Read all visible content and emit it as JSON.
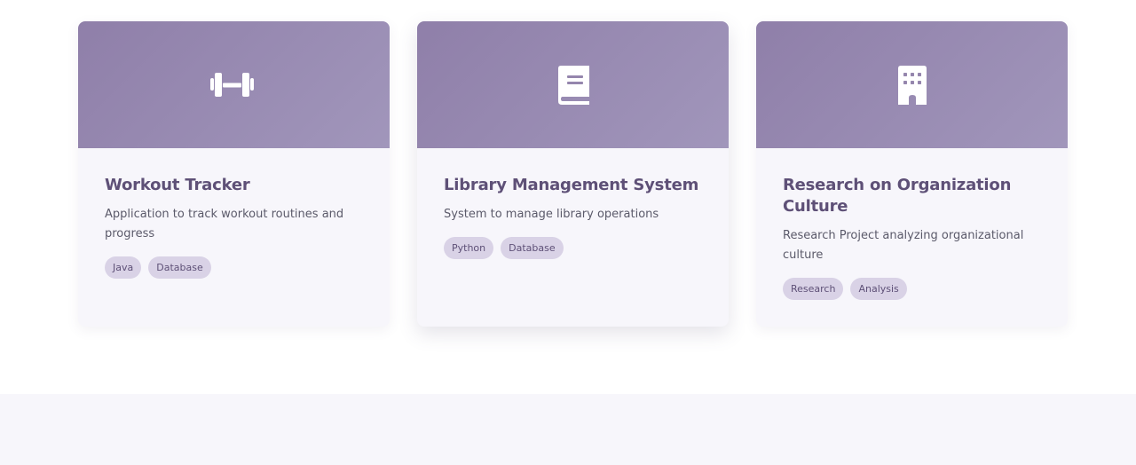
{
  "theme": {
    "banner_color": "#9586ad",
    "card_bg": "#f7f6fb",
    "title_color": "#5e5077",
    "tag_bg": "#d9d2e6"
  },
  "projects": [
    {
      "icon": "dumbbell-icon",
      "title": "Workout Tracker",
      "description": "Application to track workout routines and progress",
      "tags": [
        "Java",
        "Database"
      ]
    },
    {
      "icon": "book-icon",
      "title": "Library Management System",
      "description": "System to manage library operations",
      "tags": [
        "Python",
        "Database"
      ]
    },
    {
      "icon": "building-icon",
      "title": "Research on Organization Culture",
      "description": "Research Project analyzing organizational culture",
      "tags": [
        "Research",
        "Analysis"
      ]
    }
  ]
}
